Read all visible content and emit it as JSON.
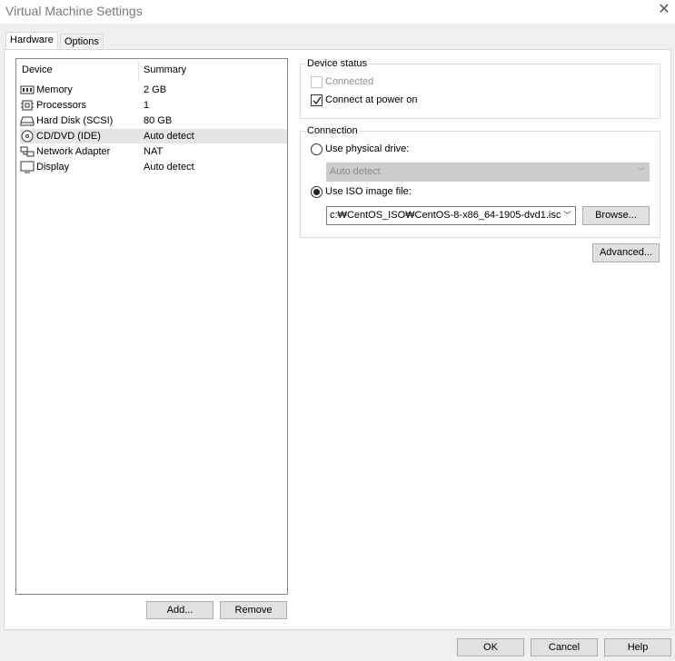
{
  "window": {
    "title": "Virtual Machine Settings",
    "close_glyph": "✕"
  },
  "tabs": [
    {
      "label": "Hardware",
      "active": true
    },
    {
      "label": "Options",
      "active": false
    }
  ],
  "device_table": {
    "columns": [
      "Device",
      "Summary"
    ],
    "rows": [
      {
        "device": "Memory",
        "summary": "2 GB",
        "icon": "memory-icon"
      },
      {
        "device": "Processors",
        "summary": "1",
        "icon": "processor-icon"
      },
      {
        "device": "Hard Disk (SCSI)",
        "summary": "80 GB",
        "icon": "hard-disk-icon"
      },
      {
        "device": "CD/DVD (IDE)",
        "summary": "Auto detect",
        "icon": "cd-dvd-icon",
        "selected": true
      },
      {
        "device": "Network Adapter",
        "summary": "NAT",
        "icon": "network-adapter-icon"
      },
      {
        "device": "Display",
        "summary": "Auto detect",
        "icon": "display-icon"
      }
    ]
  },
  "list_buttons": {
    "add": "Add...",
    "remove": "Remove"
  },
  "device_status": {
    "legend": "Device status",
    "connected_label": "Connected",
    "connected_checked": false,
    "connected_enabled": false,
    "power_on_label": "Connect at power on",
    "power_on_checked": true
  },
  "connection": {
    "legend": "Connection",
    "physical_label": "Use physical drive:",
    "physical_value": "Auto detect",
    "iso_label": "Use ISO image file:",
    "iso_value": "c:\\CentOS_ISO\\CentOS-8-x86_64-1905-dvd1.iso",
    "iso_display": "c:₩CentOS_ISO₩CentOS-8-x86_64-1905-dvd1.isc",
    "browse_label": "Browse...",
    "selected": "iso"
  },
  "advanced_label": "Advanced...",
  "footer": {
    "ok": "OK",
    "cancel": "Cancel",
    "help": "Help"
  }
}
